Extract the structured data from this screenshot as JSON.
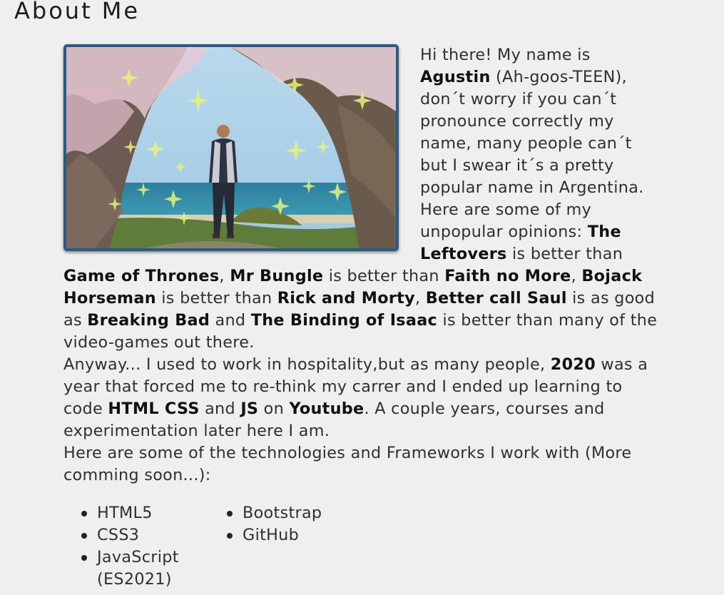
{
  "section": {
    "title": "About Me"
  },
  "photo": {
    "alt_icon": "profile-photo",
    "colors": {
      "frame": "#2a5a88",
      "sky": "#9ec9e4",
      "sea": "#2e8aa6",
      "grass": "#5f7d3a",
      "blossom": "#e6c9d3",
      "sparkle": "#e6f27a"
    }
  },
  "bio": {
    "p1": {
      "t1": "Hi there! My name is ",
      "name": "Agustin",
      "t2": " (Ah-goos-TEEN), don´t worry if you can´t pronounce correctly my name, many people can´t but I swear it´s a pretty popular name in Argentina."
    },
    "p2": {
      "t1": "Here are some of my unpopular opinions: ",
      "b1": "The Leftovers",
      "t2": " is better than ",
      "b2": "Game of Thrones",
      "t3": ", ",
      "b3": "Mr Bungle",
      "t4": " is better than ",
      "b4": "Faith no More",
      "t5": ", ",
      "b5": "Bojack Horseman",
      "t6": " is better than ",
      "b6": "Rick and Morty",
      "t7": ", ",
      "b7": "Better call Saul",
      "t8": " is as good as ",
      "b8": "Breaking Bad",
      "t9": " and ",
      "b9": "The Binding of Isaac",
      "t10": " is better than many of the video-games out there."
    },
    "p3": {
      "t1": "Anyway... I used to work in hospitality,but as many people, ",
      "b1": "2020",
      "t2": " was a year that forced me to re-think my carrer and I ended up learning to code ",
      "b2": "HTML CSS",
      "t3": " and ",
      "b3": "JS",
      "t4": " on ",
      "b4": "Youtube",
      "t5": ". A couple years, courses and experimentation later here I am."
    },
    "p4": "Here are some of the technologies and Frameworks I work with (More comming soon...):"
  },
  "technologies": [
    "HTML5",
    "CSS3",
    "JavaScript (ES2021)",
    "Bootstrap",
    "GitHub"
  ]
}
